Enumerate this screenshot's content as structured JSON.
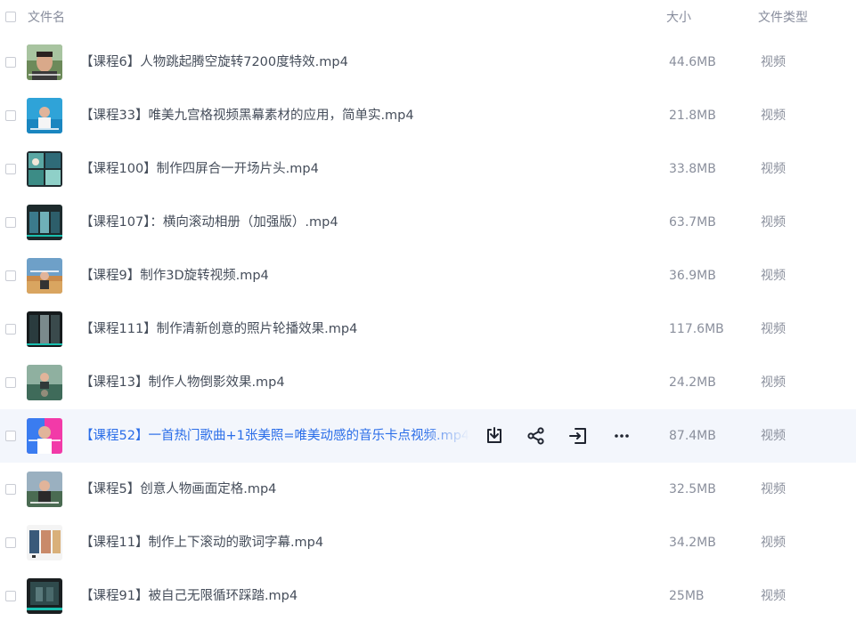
{
  "header": {
    "name_label": "文件名",
    "size_label": "大小",
    "type_label": "文件类型"
  },
  "rows": [
    {
      "name": "【课程6】人物跳起腾空旋转7200度特效.mp4",
      "size": "44.6MB",
      "type": "视频"
    },
    {
      "name": "【课程33】唯美九宫格视频黑幕素材的应用，简单实.mp4",
      "size": "21.8MB",
      "type": "视频"
    },
    {
      "name": "【课程100】制作四屏合一开场片头.mp4",
      "size": "33.8MB",
      "type": "视频"
    },
    {
      "name": "【课程107】：横向滚动相册（加强版）.mp4",
      "size": "63.7MB",
      "type": "视频"
    },
    {
      "name": "【课程9】制作3D旋转视频.mp4",
      "size": "36.9MB",
      "type": "视频"
    },
    {
      "name": "【课程111】制作清新创意的照片轮播效果.mp4",
      "size": "117.6MB",
      "type": "视频"
    },
    {
      "name": "【课程13】制作人物倒影效果.mp4",
      "size": "24.2MB",
      "type": "视频"
    },
    {
      "name": "【课程52】一首热门歌曲+1张美照=唯美动感的音乐卡点视频.mp4",
      "size": "87.4MB",
      "type": "视频"
    },
    {
      "name": "【课程5】创意人物画面定格.mp4",
      "size": "32.5MB",
      "type": "视频"
    },
    {
      "name": "【课程11】制作上下滚动的歌词字幕.mp4",
      "size": "34.2MB",
      "type": "视频"
    },
    {
      "name": "【课程91】被自己无限循环踩踏.mp4",
      "size": "25MB",
      "type": "视频"
    }
  ],
  "hover_row_index": 7,
  "hover_actions": [
    "download-icon",
    "share-icon",
    "move-to-icon",
    "more-icon"
  ],
  "colors": {
    "hover_background": "#f3f6fc",
    "hover_text": "#2a6de8",
    "muted_text": "#8a8f9c"
  }
}
